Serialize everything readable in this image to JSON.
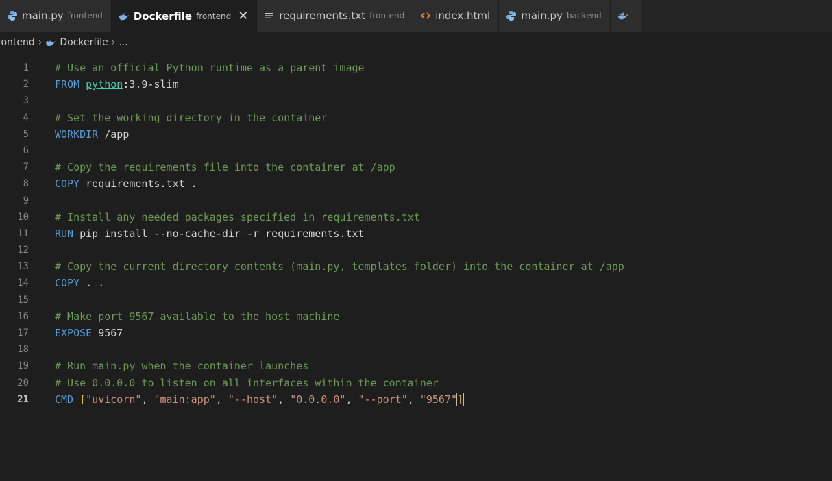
{
  "colors": {
    "editor_bg": "#1e1e1e",
    "tabbar_bg": "#252526",
    "comment": "#6a9955",
    "keyword": "#569cd6",
    "string": "#ce9178",
    "number": "#b5cea8",
    "link": "#4ec9b0"
  },
  "tabs": [
    {
      "name": "main.py",
      "description": "frontend",
      "icon": "python-icon",
      "active": false
    },
    {
      "name": "Dockerfile",
      "description": "frontend",
      "icon": "docker-icon",
      "active": true,
      "close": "✕"
    },
    {
      "name": "requirements.txt",
      "description": "frontend",
      "icon": "text-lines-icon",
      "active": false
    },
    {
      "name": "index.html",
      "description": "",
      "icon": "html-icon",
      "active": false
    },
    {
      "name": "main.py",
      "description": "backend",
      "icon": "python-icon",
      "active": false
    },
    {
      "name": "",
      "description": "",
      "icon": "docker-icon",
      "active": false
    }
  ],
  "breadcrumb": {
    "folder": "rontend",
    "file": "Dockerfile",
    "symbol": "..."
  },
  "editor": {
    "current_line": 21,
    "lines": [
      {
        "n": "1",
        "tokens": [
          {
            "t": "comment",
            "v": "# Use an official Python runtime as a parent image"
          }
        ]
      },
      {
        "n": "2",
        "tokens": [
          {
            "t": "keyword",
            "v": "FROM "
          },
          {
            "t": "link",
            "v": "python"
          },
          {
            "t": "text",
            "v": ":3.9-slim"
          }
        ]
      },
      {
        "n": "3",
        "tokens": []
      },
      {
        "n": "4",
        "tokens": [
          {
            "t": "comment",
            "v": "# Set the working directory in the container"
          }
        ]
      },
      {
        "n": "5",
        "tokens": [
          {
            "t": "keyword",
            "v": "WORKDIR "
          },
          {
            "t": "text",
            "v": "/app"
          }
        ]
      },
      {
        "n": "6",
        "tokens": []
      },
      {
        "n": "7",
        "tokens": [
          {
            "t": "comment",
            "v": "# Copy the requirements file into the container at /app"
          }
        ]
      },
      {
        "n": "8",
        "tokens": [
          {
            "t": "keyword",
            "v": "COPY "
          },
          {
            "t": "text",
            "v": "requirements.txt ."
          }
        ]
      },
      {
        "n": "9",
        "tokens": []
      },
      {
        "n": "10",
        "tokens": [
          {
            "t": "comment",
            "v": "# Install any needed packages specified in requirements.txt"
          }
        ]
      },
      {
        "n": "11",
        "tokens": [
          {
            "t": "keyword",
            "v": "RUN "
          },
          {
            "t": "text",
            "v": "pip install --no-cache-dir -r requirements.txt"
          }
        ]
      },
      {
        "n": "12",
        "tokens": []
      },
      {
        "n": "13",
        "tokens": [
          {
            "t": "comment",
            "v": "# Copy the current directory contents (main.py, templates folder) into the container at /app"
          }
        ]
      },
      {
        "n": "14",
        "tokens": [
          {
            "t": "keyword",
            "v": "COPY "
          },
          {
            "t": "text",
            "v": ". ."
          }
        ]
      },
      {
        "n": "15",
        "tokens": []
      },
      {
        "n": "16",
        "tokens": [
          {
            "t": "comment",
            "v": "# Make port 9567 available to the host machine"
          }
        ]
      },
      {
        "n": "17",
        "tokens": [
          {
            "t": "keyword",
            "v": "EXPOSE "
          },
          {
            "t": "text",
            "v": "9567"
          }
        ]
      },
      {
        "n": "18",
        "tokens": []
      },
      {
        "n": "19",
        "tokens": [
          {
            "t": "comment",
            "v": "# Run main.py when the container launches"
          }
        ]
      },
      {
        "n": "20",
        "tokens": [
          {
            "t": "comment",
            "v": "# Use 0.0.0.0 to listen on all interfaces within the container"
          }
        ]
      },
      {
        "n": "21",
        "tokens": [
          {
            "t": "keyword",
            "v": "CMD "
          },
          {
            "t": "bracket",
            "v": "["
          },
          {
            "t": "string",
            "v": "\"uvicorn\""
          },
          {
            "t": "text",
            "v": ", "
          },
          {
            "t": "string",
            "v": "\"main:app\""
          },
          {
            "t": "text",
            "v": ", "
          },
          {
            "t": "string",
            "v": "\"--host\""
          },
          {
            "t": "text",
            "v": ", "
          },
          {
            "t": "string",
            "v": "\"0.0.0.0\""
          },
          {
            "t": "text",
            "v": ", "
          },
          {
            "t": "string",
            "v": "\"--port\""
          },
          {
            "t": "text",
            "v": ", "
          },
          {
            "t": "string",
            "v": "\"9567\""
          },
          {
            "t": "bracket",
            "v": "]"
          }
        ]
      }
    ]
  }
}
